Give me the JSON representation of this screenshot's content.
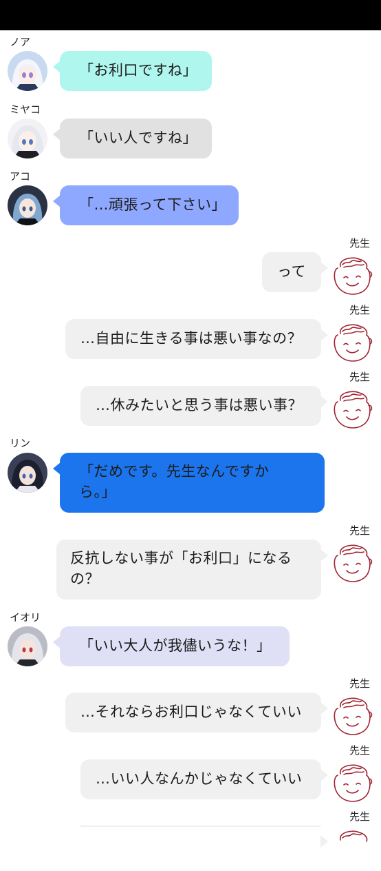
{
  "colors": {
    "noa_bubble": "#aef6ee",
    "miyako_bubble": "#e1e1e1",
    "ako_bubble": "#8fa8ff",
    "rin_bubble": "#1c75ec",
    "iori_bubble": "#dfdff6",
    "sensei_bubble": "#f0f0f0",
    "sensei_face": "#a02231"
  },
  "messages": [
    {
      "speaker": "ノア",
      "text": "「お利口ですね」"
    },
    {
      "speaker": "ミヤコ",
      "text": "「いい人ですね」"
    },
    {
      "speaker": "アコ",
      "text": "「…頑張って下さい」"
    },
    {
      "speaker": "先生",
      "text": "って"
    },
    {
      "speaker": "先生",
      "text": "…自由に生きる事は悪い事なの？"
    },
    {
      "speaker": "先生",
      "text": "…休みたいと思う事は悪い事？"
    },
    {
      "speaker": "リン",
      "line1": "「だめです。先生なんですか",
      "line2": "ら。」"
    },
    {
      "speaker": "先生",
      "line1": "反抗しない事が「お利口」になる",
      "line2": "の？"
    },
    {
      "speaker": "イオリ",
      "text": "「いい大人が我儘いうな！」"
    },
    {
      "speaker": "先生",
      "text": "…それならお利口じゃなくていい"
    },
    {
      "speaker": "先生",
      "text": "…いい人なんかじゃなくていい"
    },
    {
      "speaker": "先生"
    }
  ]
}
